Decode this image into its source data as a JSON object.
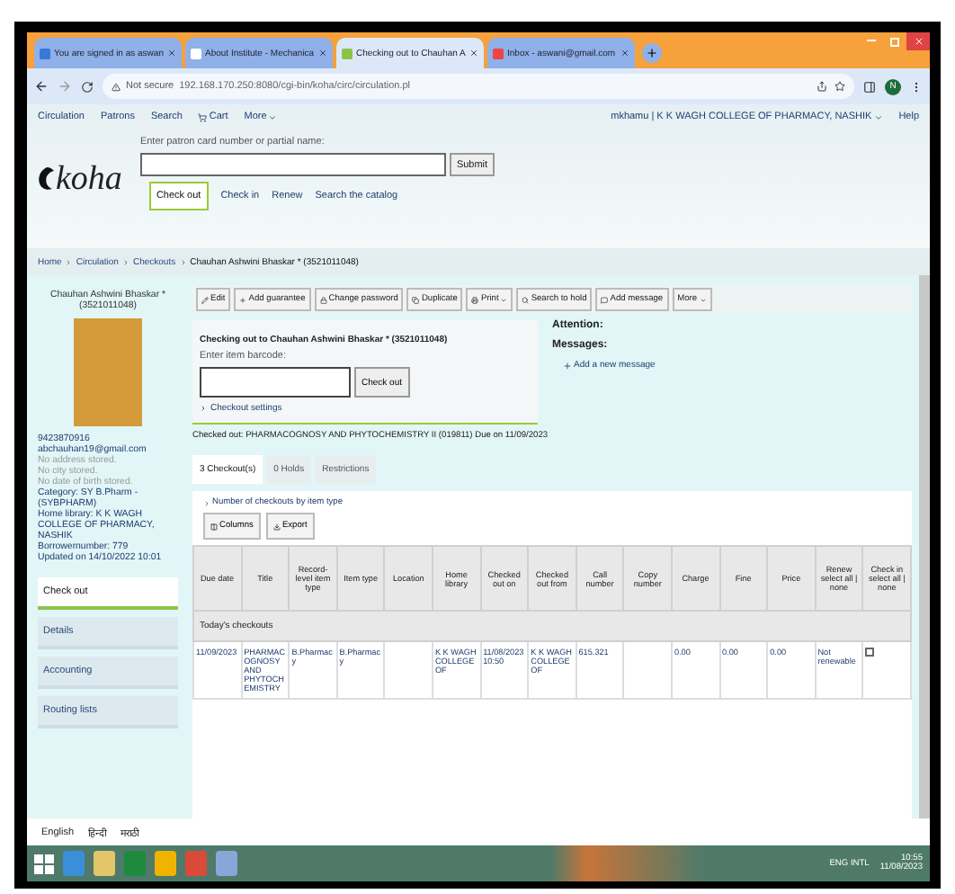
{
  "browser": {
    "tabs": [
      {
        "title": "You are signed in as aswan",
        "selected": false
      },
      {
        "title": "About Institute - Mechanica",
        "selected": false
      },
      {
        "title": "Checking out to Chauhan A",
        "selected": true
      },
      {
        "title": "Inbox - aswani@gmail.com",
        "selected": false
      }
    ],
    "security": "Not secure",
    "url": "192.168.170.250:8080/cgi-bin/koha/circ/circulation.pl",
    "profile": "N"
  },
  "logo": "koha",
  "nav": {
    "items": [
      "Circulation",
      "Patrons",
      "Search",
      "Cart",
      "More"
    ],
    "user": "mkhamu | K K WAGH COLLEGE OF PHARMACY, NASHIK",
    "help": "Help"
  },
  "search": {
    "label": "Enter patron card number or partial name:",
    "button": "Submit",
    "tabs": [
      {
        "label": "Check out",
        "selected": true
      },
      {
        "label": "Check in",
        "selected": false
      },
      {
        "label": "Renew",
        "selected": false
      },
      {
        "label": "Search the catalog",
        "selected": false
      }
    ]
  },
  "breadcrumb": [
    "Home",
    "Circulation",
    "Checkouts",
    "Chauhan Ashwini Bhaskar * (3521011048)"
  ],
  "patron": {
    "name": "Chauhan Ashwini Bhaskar * (3521011048)",
    "phone": "9423870916",
    "email": "abchauhan19@gmail.com",
    "missing": [
      "No address stored.",
      "No city stored.",
      "No date of birth stored."
    ],
    "details": [
      "Category: SY B.Pharm - (SYBPHARM)",
      "Home library: K K WAGH COLLEGE OF PHARMACY, NASHIK",
      "Borrowernumber: 779",
      "Updated on 14/10/2022 10:01"
    ]
  },
  "side_menu": [
    {
      "label": "Check out",
      "selected": true
    },
    {
      "label": "Details",
      "selected": false
    },
    {
      "label": "Accounting",
      "selected": false
    },
    {
      "label": "Routing lists",
      "selected": false
    }
  ],
  "toolbar": [
    {
      "kind": "edit",
      "label": "Edit"
    },
    {
      "kind": "add",
      "label": "Add guarantee"
    },
    {
      "kind": "lock",
      "label": "Change password"
    },
    {
      "kind": "copy",
      "label": "Duplicate"
    },
    {
      "kind": "print",
      "label": "Print"
    },
    {
      "kind": "search",
      "label": "Search to hold"
    },
    {
      "kind": "message",
      "label": "Add message"
    },
    {
      "kind": "more",
      "label": "More"
    }
  ],
  "checkout": {
    "heading": "Checking out to Chauhan Ashwini Bhaskar * (3521011048)",
    "barcode_label": "Enter item barcode:",
    "button": "Check out",
    "settings": "Checkout settings",
    "checked_out": "Checked out: PHARMACOGNOSY AND PHYTOCHEMISTRY II (019811) Due on 11/09/2023"
  },
  "attention": {
    "title": "Attention:",
    "messages": "Messages:",
    "add": "Add a new message"
  },
  "tabs": [
    {
      "label": "3 Checkout(s)",
      "selected": true
    },
    {
      "label": "0 Holds",
      "selected": false
    },
    {
      "label": "Restrictions",
      "selected": false
    }
  ],
  "table": {
    "summary_link": "Number of checkouts by item type",
    "buttons": [
      {
        "kind": "columns",
        "label": "Columns"
      },
      {
        "kind": "export",
        "label": "Export"
      }
    ],
    "columns": [
      "Due date",
      "Title",
      "Record-level item type",
      "Item type",
      "Location",
      "Home library",
      "Checked out on",
      "Checked out from",
      "Call number",
      "Copy number",
      "Charge",
      "Fine",
      "Price",
      "Renew select all | none",
      "Check in select all | none"
    ],
    "group": "Today's checkouts",
    "rows": [
      {
        "cells": [
          "11/09/2023",
          "PHARMACOGNOSY AND PHYTOCHEMISTRY",
          "B.Pharmacy",
          "B.Pharmacy",
          "",
          "K K WAGH COLLEGE OF",
          "11/08/2023 10:50",
          "K K WAGH COLLEGE OF",
          "615.321",
          "",
          "0.00",
          "0.00",
          "0.00",
          "Not renewable"
        ],
        "checkin_checked": false
      }
    ]
  },
  "languages": [
    "English",
    "हिन्दी",
    "मराठी"
  ],
  "taskbar": {
    "tray": "ENG INTL",
    "time": "10:55",
    "date": "11/08/2023"
  }
}
